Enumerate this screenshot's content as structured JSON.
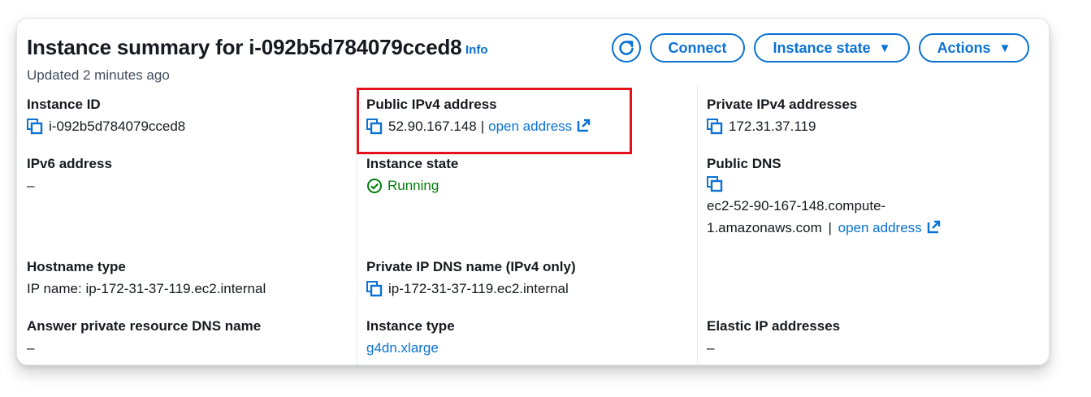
{
  "header": {
    "title": "Instance summary for i-092b5d784079cced8",
    "info_link": "Info",
    "updated": "Updated 2 minutes ago"
  },
  "toolbar": {
    "refresh_icon": "refresh-icon",
    "connect_label": "Connect",
    "instance_state_label": "Instance state",
    "actions_label": "Actions",
    "caret": "▼"
  },
  "fields": {
    "instance_id": {
      "label": "Instance ID",
      "value": "i-092b5d784079cced8"
    },
    "public_ipv4": {
      "label": "Public IPv4 address",
      "value": "52.90.167.148",
      "separator": "|",
      "link": "open address"
    },
    "private_ipv4": {
      "label": "Private IPv4 addresses",
      "value": "172.31.37.119"
    },
    "ipv6": {
      "label": "IPv6 address",
      "value": "–"
    },
    "instance_state": {
      "label": "Instance state",
      "value": "Running"
    },
    "public_dns": {
      "label": "Public DNS",
      "value_line1": "ec2-52-90-167-148.compute-",
      "value_line2": "1.amazonaws.com",
      "separator": "|",
      "link": "open address"
    },
    "hostname_type": {
      "label": "Hostname type",
      "value": "IP name: ip-172-31-37-119.ec2.internal"
    },
    "private_ip_dns": {
      "label": "Private IP DNS name (IPv4 only)",
      "value": "ip-172-31-37-119.ec2.internal"
    },
    "answer_private_dns": {
      "label": "Answer private resource DNS name",
      "value": "–"
    },
    "instance_type": {
      "label": "Instance type",
      "value": "g4dn.xlarge"
    },
    "elastic_ip": {
      "label": "Elastic IP addresses",
      "value": "–"
    }
  },
  "colors": {
    "link": "#0972d3",
    "running": "#037f0c",
    "highlight": "#e3121b"
  }
}
